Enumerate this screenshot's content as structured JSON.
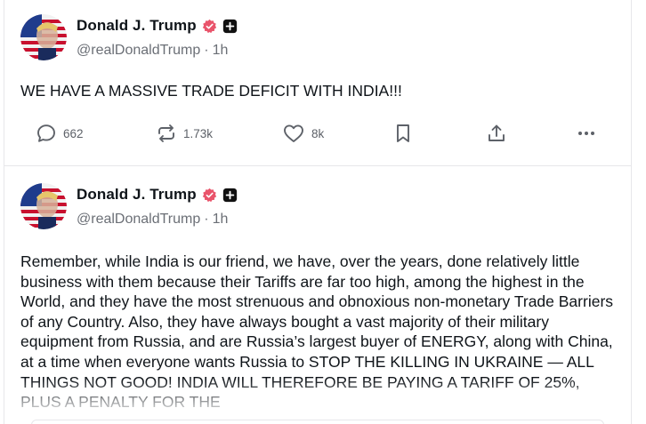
{
  "posts": [
    {
      "author": {
        "display_name": "Donald J. Trump",
        "handle": "@realDonaldTrump",
        "verified_icon": "verified-badge-icon",
        "plus_icon": "plus-badge-icon"
      },
      "separator": "·",
      "time": "1h",
      "text": "WE HAVE A MASSIVE TRADE DEFICIT WITH INDIA!!!",
      "actions": {
        "replies": "662",
        "reposts": "1.73k",
        "likes": "8k"
      }
    },
    {
      "author": {
        "display_name": "Donald J. Trump",
        "handle": "@realDonaldTrump",
        "verified_icon": "verified-badge-icon",
        "plus_icon": "plus-badge-icon"
      },
      "separator": "·",
      "time": "1h",
      "text": "Remember, while India is our friend, we have, over the years, done relatively little business with them because their Tariffs are far too high, among the highest in the World, and they have the most strenuous and obnoxious non-monetary Trade Barriers of any Country. Also, they have always bought a vast majority of their military equipment from Russia, and are Russia’s largest buyer of ENERGY, along with China, at a time when everyone wants Russia to STOP THE KILLING IN UKRAINE — ALL THINGS NOT GOOD! INDIA WILL THEREFORE BE PAYING A TARIFF OF 25%, PLUS A PENALTY FOR THE"
    }
  ],
  "colors": {
    "verified": "#e9546b",
    "text": "#0f1419",
    "muted": "#6b6f76",
    "divider": "#e7e7ea"
  }
}
